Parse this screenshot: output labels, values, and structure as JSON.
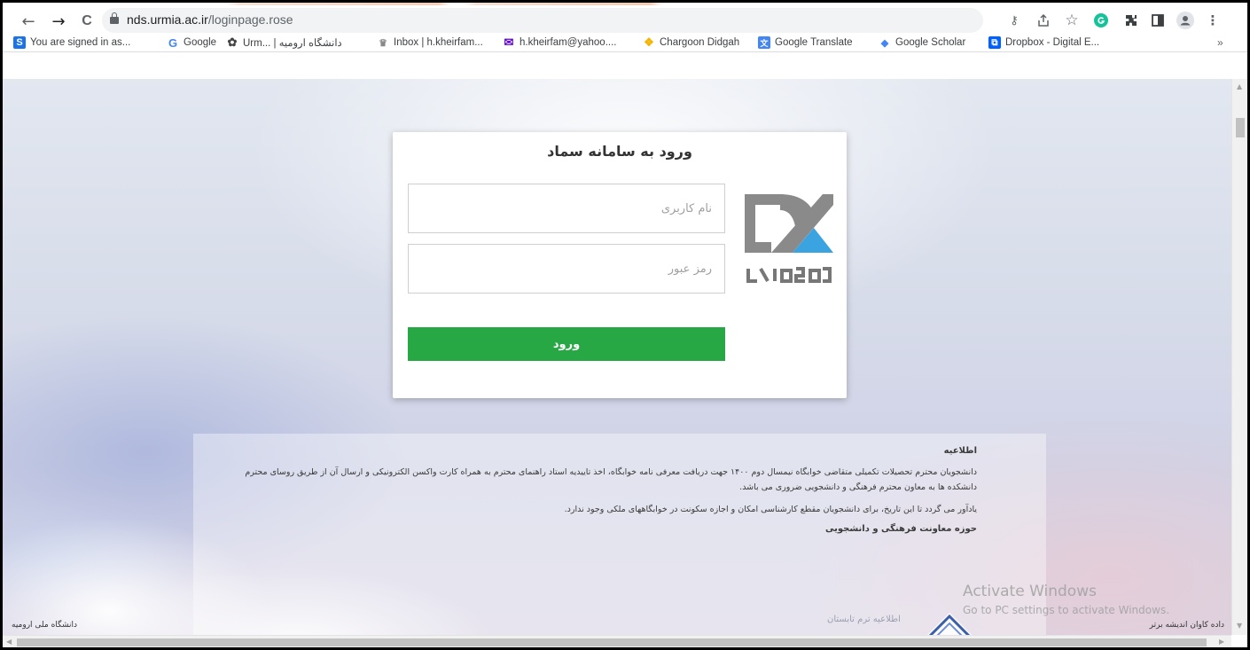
{
  "browser": {
    "url_host": "nds.urmia.ac.ir",
    "url_path": "/loginpage.rose",
    "nav": {
      "back": "←",
      "forward": "→",
      "reload": "C"
    },
    "toolbar_icons": [
      "key-icon",
      "share-icon",
      "star-icon",
      "grammarly-icon",
      "extensions-icon",
      "sidepanel-icon",
      "profile-icon",
      "menu-icon"
    ],
    "bookmarks": [
      {
        "label": "You are signed in as...",
        "icon": "S",
        "color": "#1a73e8"
      },
      {
        "label": "Google",
        "icon": "G",
        "color": "#4285f4"
      },
      {
        "label": "Urm... | دانشگاه ارومیه",
        "icon": "✿",
        "color": "#555555"
      },
      {
        "label": "Inbox | h.kheirfam...",
        "icon": "♛",
        "color": "#888888"
      },
      {
        "label": "h.kheirfam@yahoo....",
        "icon": "✉",
        "color": "#6001d2"
      },
      {
        "label": "Chargoon Didgah",
        "icon": "❖",
        "color": "#f4b400"
      },
      {
        "label": "Google Translate",
        "icon": "文",
        "color": "#4285f4"
      },
      {
        "label": "Google Scholar",
        "icon": "◆",
        "color": "#4285f4"
      },
      {
        "label": "Dropbox - Digital E...",
        "icon": "⧉",
        "color": "#0061ff"
      }
    ],
    "bookmarks_overflow": "»"
  },
  "login": {
    "title": "ورود به سامانه سماد",
    "username_placeholder": "نام کاربری",
    "password_placeholder": "رمز عبور",
    "submit_label": "ورود",
    "brand_accent": "#3ba3e0",
    "brand_gray": "#8a8a8a"
  },
  "notice": {
    "title": "اطلاعیه",
    "paragraph1": "دانشجویان محترم تحصیلات تکمیلی متقاضی خوابگاه نیمسال دوم ۱۴۰۰ جهت دریافت معرفی نامه خوابگاه، اخذ تاییدیه استاد راهنمای محترم به همراه کارت واکسن الکترونیکی و ارسال آن از طریق روسای محترم دانشکده ها به معاون محترم فرهنگی و دانشجویی ضروری می باشد.",
    "paragraph2": "یادآور می گردد تا این تاریخ، برای دانشجویان مقطع کارشناسی امکان و اجازه سکونت در خوابگاههای ملکی وجود ندارد.",
    "signature": "حوزه معاونت فرهنگی و دانشجویی"
  },
  "footer": {
    "left": "دانشگاه ملی ارومیه",
    "right": "داده کاوان اندیشه برتر",
    "summer": "اطلاعیه ترم تابستان"
  },
  "watermark": {
    "title": "Activate Windows",
    "subtitle": "Go to PC settings to activate Windows."
  }
}
